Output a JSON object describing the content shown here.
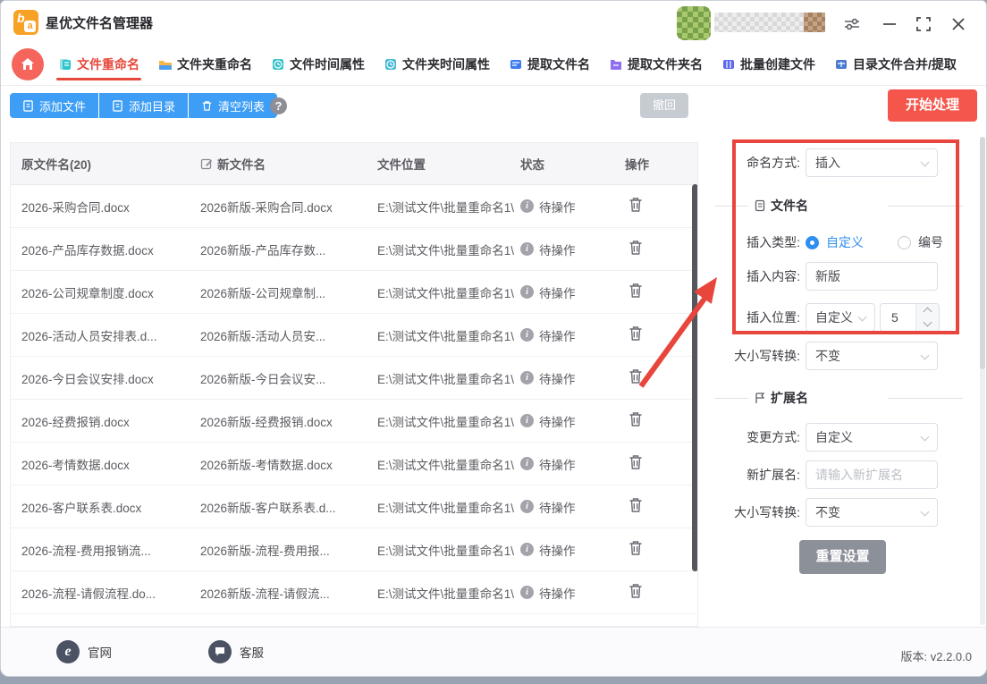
{
  "app": {
    "title": "星优文件名管理器"
  },
  "tabs": [
    {
      "label": "文件重命名",
      "active": true
    },
    {
      "label": "文件夹重命名",
      "active": false
    },
    {
      "label": "文件时间属性",
      "active": false
    },
    {
      "label": "文件夹时间属性",
      "active": false
    },
    {
      "label": "提取文件名",
      "active": false
    },
    {
      "label": "提取文件夹名",
      "active": false
    },
    {
      "label": "批量创建文件",
      "active": false
    },
    {
      "label": "目录文件合并/提取",
      "active": false
    }
  ],
  "toolbar": {
    "add_file_label": "添加文件",
    "add_dir_label": "添加目录",
    "clear_label": "清空列表",
    "help_glyph": "?",
    "undo_label": "撤回",
    "start_label": "开始处理"
  },
  "table": {
    "col_orig": "原文件名(20)",
    "col_new": "新文件名",
    "col_path": "文件位置",
    "col_status": "状态",
    "col_action": "操作",
    "info_glyph": "i",
    "rows": [
      {
        "orig": "2026-采购合同.docx",
        "new": "2026新版-采购合同.docx",
        "path": "E:\\测试文件\\批量重命名1\\",
        "status": "待操作"
      },
      {
        "orig": "2026-产品库存数据.docx",
        "new": "2026新版-产品库存数...",
        "path": "E:\\测试文件\\批量重命名1\\",
        "status": "待操作"
      },
      {
        "orig": "2026-公司规章制度.docx",
        "new": "2026新版-公司规章制...",
        "path": "E:\\测试文件\\批量重命名1\\",
        "status": "待操作"
      },
      {
        "orig": "2026-活动人员安排表.d...",
        "new": "2026新版-活动人员安...",
        "path": "E:\\测试文件\\批量重命名1\\",
        "status": "待操作"
      },
      {
        "orig": "2026-今日会议安排.docx",
        "new": "2026新版-今日会议安...",
        "path": "E:\\测试文件\\批量重命名1\\",
        "status": "待操作"
      },
      {
        "orig": "2026-经费报销.docx",
        "new": "2026新版-经费报销.docx",
        "path": "E:\\测试文件\\批量重命名1\\",
        "status": "待操作"
      },
      {
        "orig": "2026-考情数据.docx",
        "new": "2026新版-考情数据.docx",
        "path": "E:\\测试文件\\批量重命名1\\",
        "status": "待操作"
      },
      {
        "orig": "2026-客户联系表.docx",
        "new": "2026新版-客户联系表.d...",
        "path": "E:\\测试文件\\批量重命名1\\",
        "status": "待操作"
      },
      {
        "orig": "2026-流程-费用报销流...",
        "new": "2026新版-流程-费用报...",
        "path": "E:\\测试文件\\批量重命名1\\",
        "status": "待操作"
      },
      {
        "orig": "2026-流程-请假流程.do...",
        "new": "2026新版-流程-请假流...",
        "path": "E:\\测试文件\\批量重命名1\\",
        "status": "待操作"
      }
    ]
  },
  "settings": {
    "naming_label": "命名方式:",
    "naming_value": "插入",
    "filename_section": "文件名",
    "insert_type_label": "插入类型:",
    "opt_custom": "自定义",
    "opt_number": "编号",
    "insert_content_label": "插入内容:",
    "insert_content_value": "新版",
    "insert_pos_label": "插入位置:",
    "insert_pos_value": "自定义",
    "insert_pos_num": "5",
    "case_label": "大小写转换:",
    "case_value": "不变",
    "ext_section": "扩展名",
    "change_mode_label": "变更方式:",
    "change_mode_value": "自定义",
    "new_ext_label": "新扩展名:",
    "new_ext_placeholder": "请输入新扩展名",
    "ext_case_label": "大小写转换:",
    "ext_case_value": "不变",
    "reset_label": "重置设置"
  },
  "footer": {
    "website": "官网",
    "website_glyph": "e",
    "support": "客服",
    "version_label": "版本:",
    "version": "v2.2.0.0"
  },
  "colors": {
    "accent_blue": "#3e9ef5",
    "start_red": "#f5564c",
    "tab_active_red": "#e6483a",
    "annotation_red": "#e8453c",
    "radio_blue": "#2f8ef2"
  }
}
